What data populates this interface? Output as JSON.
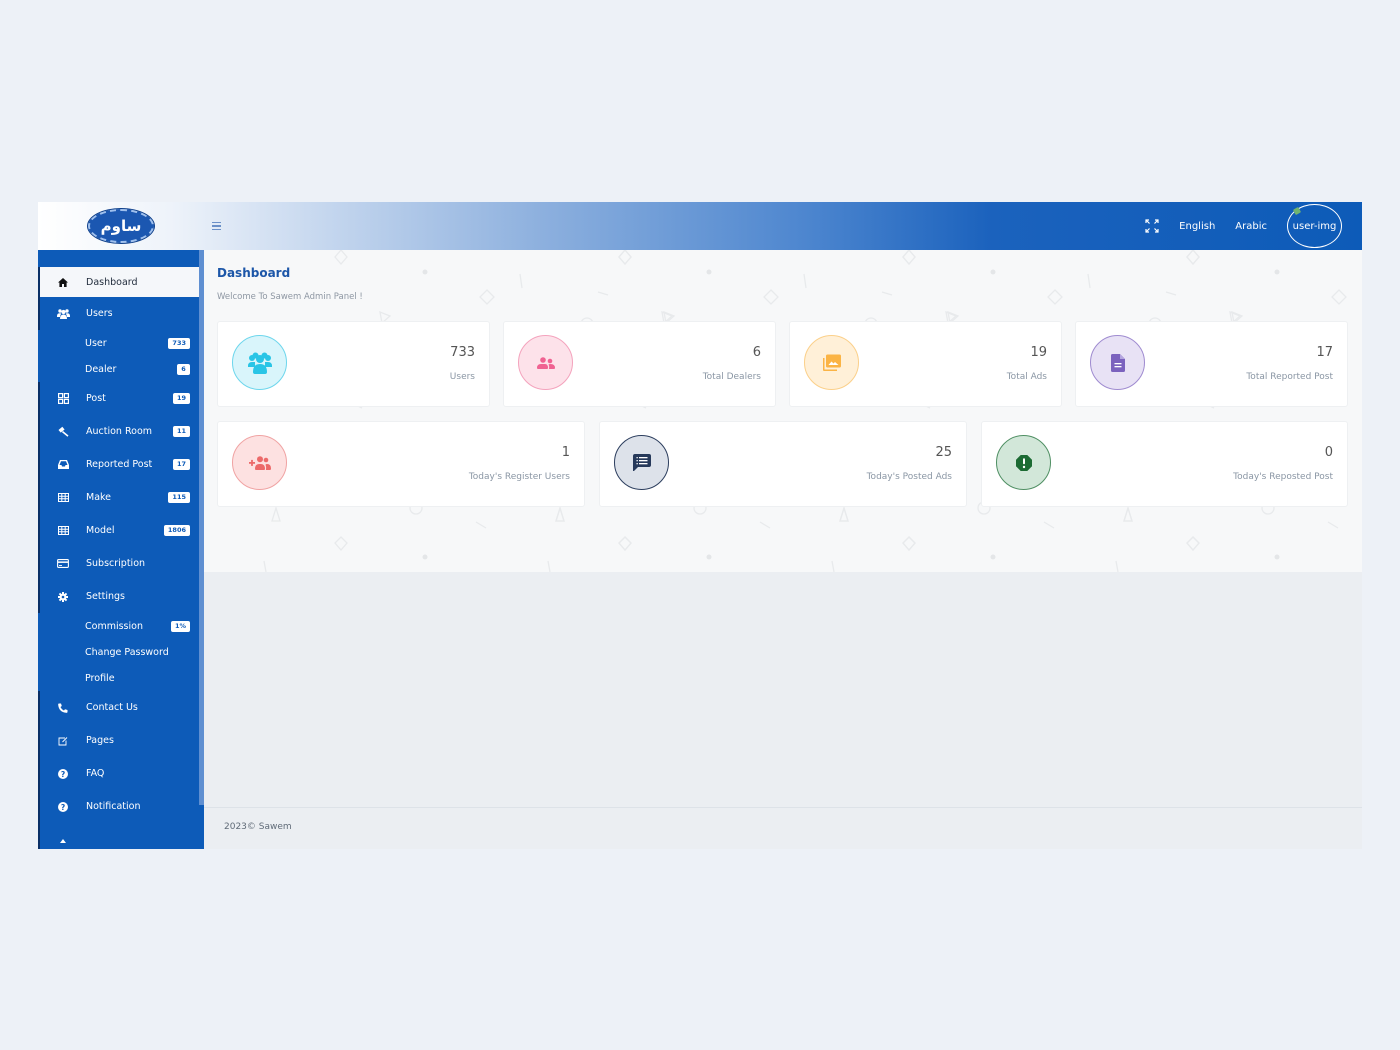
{
  "header": {
    "logo_text": "ساوم",
    "menu_icon": "hamburger-icon",
    "fullscreen_icon": "fullscreen-icon",
    "lang_english": "English",
    "lang_arabic": "Arabic",
    "user_image_alt": "user-img"
  },
  "sidebar": {
    "items": [
      {
        "key": "dashboard",
        "label": "Dashboard",
        "icon": "home-icon",
        "active": true
      },
      {
        "key": "users",
        "label": "Users",
        "icon": "users-icon"
      },
      {
        "key": "user",
        "label": "User",
        "sub": true,
        "badge": "733"
      },
      {
        "key": "dealer",
        "label": "Dealer",
        "sub": true,
        "badge": "6"
      },
      {
        "key": "post",
        "label": "Post",
        "icon": "grid-icon",
        "badge": "19"
      },
      {
        "key": "auction-room",
        "label": "Auction Room",
        "icon": "gavel-icon",
        "badge": "11"
      },
      {
        "key": "reported-post",
        "label": "Reported Post",
        "icon": "inbox-icon",
        "badge": "17"
      },
      {
        "key": "make",
        "label": "Make",
        "icon": "table-icon",
        "badge": "115"
      },
      {
        "key": "model",
        "label": "Model",
        "icon": "table-icon",
        "badge": "1806"
      },
      {
        "key": "subscription",
        "label": "Subscription",
        "icon": "credit-card-icon"
      },
      {
        "key": "settings",
        "label": "Settings",
        "icon": "gear-icon"
      },
      {
        "key": "commission",
        "label": "Commission",
        "sub": true,
        "badge": "1%"
      },
      {
        "key": "change-password",
        "label": "Change Password",
        "sub": true
      },
      {
        "key": "profile",
        "label": "Profile",
        "sub": true
      },
      {
        "key": "contact-us",
        "label": "Contact Us",
        "icon": "phone-icon"
      },
      {
        "key": "pages",
        "label": "Pages",
        "icon": "edit-icon"
      },
      {
        "key": "faq",
        "label": "FAQ",
        "icon": "question-circle-icon"
      },
      {
        "key": "notification",
        "label": "Notification",
        "icon": "question-circle-icon"
      }
    ]
  },
  "main": {
    "title": "Dashboard",
    "subtitle": "Welcome To Sawem Admin Panel !",
    "stats_row1": [
      {
        "value": "733",
        "label": "Users",
        "icon": "users-group-icon",
        "color": "#29c5e6",
        "bg": "#d9f5fb",
        "border": "#6dd6ec"
      },
      {
        "value": "6",
        "label": "Total Dealers",
        "icon": "user-friends-icon",
        "color": "#f06292",
        "bg": "#fde2ea",
        "border": "#f4a3bd"
      },
      {
        "value": "19",
        "label": "Total Ads",
        "icon": "images-icon",
        "color": "#fbb445",
        "bg": "#fff0d8",
        "border": "#fbd08a"
      },
      {
        "value": "17",
        "label": "Total Reported Post",
        "icon": "file-alt-icon",
        "color": "#7b62be",
        "bg": "#e8e2f5",
        "border": "#9f8bd0"
      }
    ],
    "stats_row2": [
      {
        "value": "1",
        "label": "Today's Register Users",
        "icon": "user-plus-icon",
        "color": "#ec6a6a",
        "bg": "#fde1e1",
        "border": "#f0a3a3"
      },
      {
        "value": "25",
        "label": "Today's Posted Ads",
        "icon": "comment-alt-icon",
        "color": "#26395a",
        "bg": "#dde2ea",
        "border": "#2c3e5e"
      },
      {
        "value": "0",
        "label": "Today's Reposted Post",
        "icon": "exclamation-octagon-icon",
        "color": "#1c6b33",
        "bg": "#d2e7d9",
        "border": "#4f8f63"
      }
    ]
  },
  "footer": {
    "text": "2023© Sawem"
  }
}
